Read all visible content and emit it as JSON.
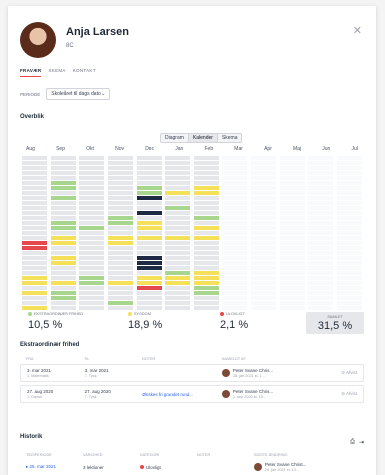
{
  "profile": {
    "name": "Anja Larsen",
    "class": "8C"
  },
  "tabs": [
    "FRAVÆR",
    "SKEMA",
    "KONTAKT"
  ],
  "period": {
    "label": "PERIODE",
    "value": "Skoleåret til dags dato"
  },
  "overview": {
    "title": "Overblik",
    "views": [
      "Diagram",
      "Kalender",
      "Skema"
    ],
    "active_view": "Kalender",
    "months": [
      "Aug",
      "Sep",
      "Okt",
      "Nov",
      "Dec",
      "Jan",
      "Feb",
      "Mar",
      "Apr",
      "Maj",
      "Jun",
      "Jul"
    ],
    "stats": [
      {
        "label": "EKSTRAORDINÆR FRIHED",
        "value": "10,5 %",
        "color": "#a8d68f"
      },
      {
        "label": "SYGDOM",
        "value": "18,9 %",
        "color": "#f5e05a"
      },
      {
        "label": "ULOVLIGT",
        "value": "2,1 %",
        "color": "#e5484d"
      },
      {
        "label": "SAMLET",
        "value": "31,5 %"
      }
    ]
  },
  "extra": {
    "title": "Ekstraordinær frihed",
    "headers": [
      "FRA",
      "TIL",
      "NOTER",
      "ANMELDT AF"
    ],
    "rows": [
      {
        "from": "3. mar 2021",
        "from_sub": "1. Matematik",
        "to": "3. mar 2021",
        "to_sub": "7. Tysk",
        "note": "",
        "by": "Peter Svane Chris...",
        "by_sub": "28. jan 2021 kl. 1...",
        "action": "Afvist"
      },
      {
        "from": "27. aug 2020",
        "from_sub": "1. Dansk",
        "to": "27. aug 2020",
        "to_sub": "7. Tysk",
        "note": "Ønskes fri grundet rund...",
        "by": "Peter Svane Chris...",
        "by_sub": "1. sep 2020 kl. 15...",
        "action": "Afvist"
      }
    ]
  },
  "history": {
    "title": "Historik",
    "headers": [
      "TIDSPERIODE",
      "VARIGHED",
      "KATEGORI",
      "NOTER",
      "SIDSTE ÆNDRING"
    ],
    "rows": [
      {
        "period": "25. mar 2021",
        "duration": "3 lektioner",
        "category": "Ulovligt",
        "note": "",
        "by": "Peter Svane Christ...",
        "by_sub": "29. jan 2021 kl. 13..."
      }
    ]
  }
}
